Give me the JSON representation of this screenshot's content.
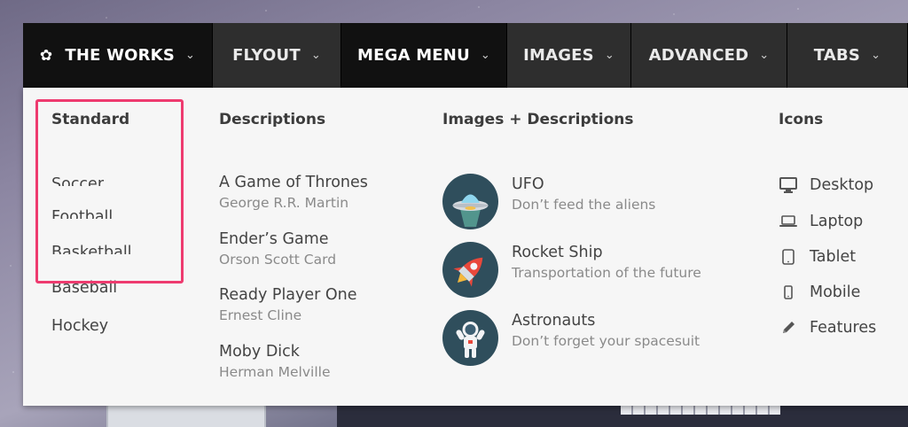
{
  "nav": {
    "items": [
      {
        "label": "THE WORKS",
        "chevron": "chevron-down-icon",
        "icon": "gear-icon"
      },
      {
        "label": "FLYOUT",
        "chevron": "chevron-down-icon"
      },
      {
        "label": "MEGA MENU",
        "chevron": "chevron-down-icon"
      },
      {
        "label": "IMAGES",
        "chevron": "chevron-down-icon"
      },
      {
        "label": "ADVANCED",
        "chevron": "chevron-down-icon"
      },
      {
        "label": "TABS",
        "chevron": "chevron-down-icon"
      }
    ],
    "gear_glyph": "✿",
    "chevron_glyph": "⌄"
  },
  "menu": {
    "standard": {
      "title": "Standard",
      "items": [
        "Soccer",
        "Football",
        "Basketball",
        "Baseball",
        "Hockey"
      ]
    },
    "descriptions": {
      "title": "Descriptions",
      "items": [
        {
          "title": "A Game of Thrones",
          "subtitle": "George R.R. Martin"
        },
        {
          "title": "Ender’s Game",
          "subtitle": "Orson Scott Card"
        },
        {
          "title": "Ready Player One",
          "subtitle": "Ernest Cline"
        },
        {
          "title": "Moby Dick",
          "subtitle": "Herman Melville"
        }
      ]
    },
    "images": {
      "title": "Images + Descriptions",
      "items": [
        {
          "title": "UFO",
          "subtitle": "Don’t feed the aliens",
          "icon": "ufo-icon"
        },
        {
          "title": "Rocket Ship",
          "subtitle": "Transportation of the future",
          "icon": "rocket-icon"
        },
        {
          "title": "Astronauts",
          "subtitle": "Don’t forget your spacesuit",
          "icon": "astronaut-icon"
        }
      ]
    },
    "icons": {
      "title": "Icons",
      "items": [
        {
          "label": "Desktop",
          "icon": "desktop-icon"
        },
        {
          "label": "Laptop",
          "icon": "laptop-icon"
        },
        {
          "label": "Tablet",
          "icon": "tablet-icon"
        },
        {
          "label": "Mobile",
          "icon": "mobile-icon"
        },
        {
          "label": "Features",
          "icon": "pencil-icon"
        }
      ]
    }
  },
  "colors": {
    "nav_bg": "#1b1b1b",
    "nav_inactive_bg": "#2e2e2e",
    "panel_bg": "#f6f6f6",
    "highlight": "#ee3b6f",
    "image_circle": "#2f4e5c"
  }
}
